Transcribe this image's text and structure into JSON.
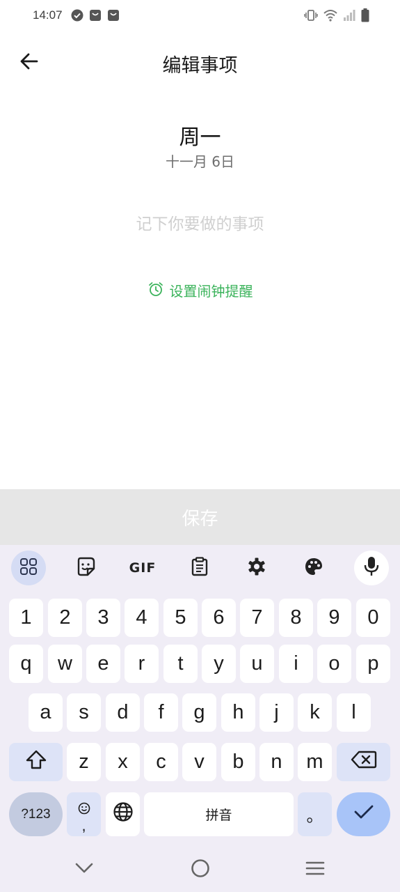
{
  "status_bar": {
    "time": "14:07",
    "left_icons": [
      "check-circle-icon",
      "notification-bag-icon",
      "notification-bag-icon"
    ],
    "right_icons": [
      "vibrate-icon",
      "wifi-icon",
      "signal-icon",
      "battery-icon"
    ]
  },
  "app_bar": {
    "title": "编辑事项",
    "back_icon": "arrow-left-icon"
  },
  "content": {
    "weekday": "周一",
    "date": "十一月 6日",
    "todo_placeholder": "记下你要做的事项",
    "alarm_label": "设置闹钟提醒",
    "alarm_icon": "alarm-clock-icon",
    "accent_color": "#3bb35b"
  },
  "save_bar": {
    "label": "保存"
  },
  "keyboard": {
    "toolbar": [
      "apps-grid-icon",
      "sticker-icon",
      "gif-icon",
      "clipboard-icon",
      "settings-gear-icon",
      "palette-icon",
      "microphone-icon"
    ],
    "gif_label": "GIF",
    "row_numbers": [
      "1",
      "2",
      "3",
      "4",
      "5",
      "6",
      "7",
      "8",
      "9",
      "0"
    ],
    "row_1": [
      "q",
      "w",
      "e",
      "r",
      "t",
      "y",
      "u",
      "i",
      "o",
      "p"
    ],
    "row_2": [
      "a",
      "s",
      "d",
      "f",
      "g",
      "h",
      "j",
      "k",
      "l"
    ],
    "row_3": [
      "z",
      "x",
      "c",
      "v",
      "b",
      "n",
      "m"
    ],
    "symbols_label": "?123",
    "emoji_comma": ",",
    "space_label": "拼音",
    "period_label": "。"
  },
  "nav_bar": {
    "icons": [
      "nav-back-chevron-icon",
      "nav-home-circle-icon",
      "nav-recents-menu-icon"
    ]
  }
}
